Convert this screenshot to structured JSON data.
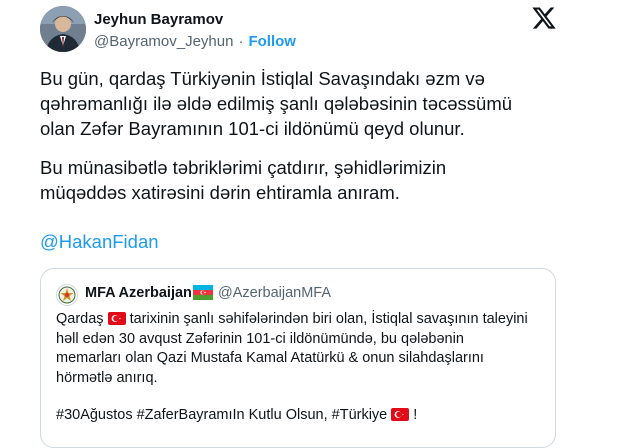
{
  "author": {
    "name": "Jeyhun Bayramov",
    "handle": "@Bayramov_Jeyhun",
    "separator": "·",
    "follow_label": "Follow"
  },
  "icons": {
    "x_logo": "x-logo-icon",
    "az_flag": "azerbaijan-flag-icon",
    "tr_flag": "turkey-flag-icon",
    "mfa_emblem": "mfa-emblem-icon"
  },
  "tweet": {
    "para1_line1": "Bu gün, qardaş Türkiyənin İstiqlal Savaşındakı əzm və",
    "para1_line2": "qəhrəmanlığı ilə əldə edilmiş şanlı qələbəsinin təcəssümü",
    "para1_line3": "olan Zəfər Bayramının 101-ci ildönümü qeyd olunur.",
    "para2_line1": "Bu münasibətlə təbriklərimi çatdırır, şəhidlərimizin",
    "para2_line2": "müqəddəs xatirəsini dərin ehtiramla anıram.",
    "mention": "@HakanFidan"
  },
  "quote": {
    "name": "MFA Azerbaijan",
    "handle": "@AzerbaijanMFA",
    "line1_a": "Qardaş",
    "line1_b": "tarixinin şanlı səhifələrindən biri olan, İstiqlal savaşının taleyini",
    "line2": "həll edən 30 avqust Zəfərinin 101-ci ildönümündə, bu qələbənin",
    "line3": "memarları olan Qazi Mustafa Kamal Atatürkü & onun silahdaşlarını",
    "line4": "hörmətlə anırıq.",
    "tags_a": "#30Ağustos #ZaferBayramıIn Kutlu Olsun, #Türkiye",
    "tags_b": "!"
  },
  "colors": {
    "link": "#1d9bf0",
    "secondary_text": "#536471",
    "border": "#cfd9de",
    "turkey_red": "#e30a17"
  }
}
